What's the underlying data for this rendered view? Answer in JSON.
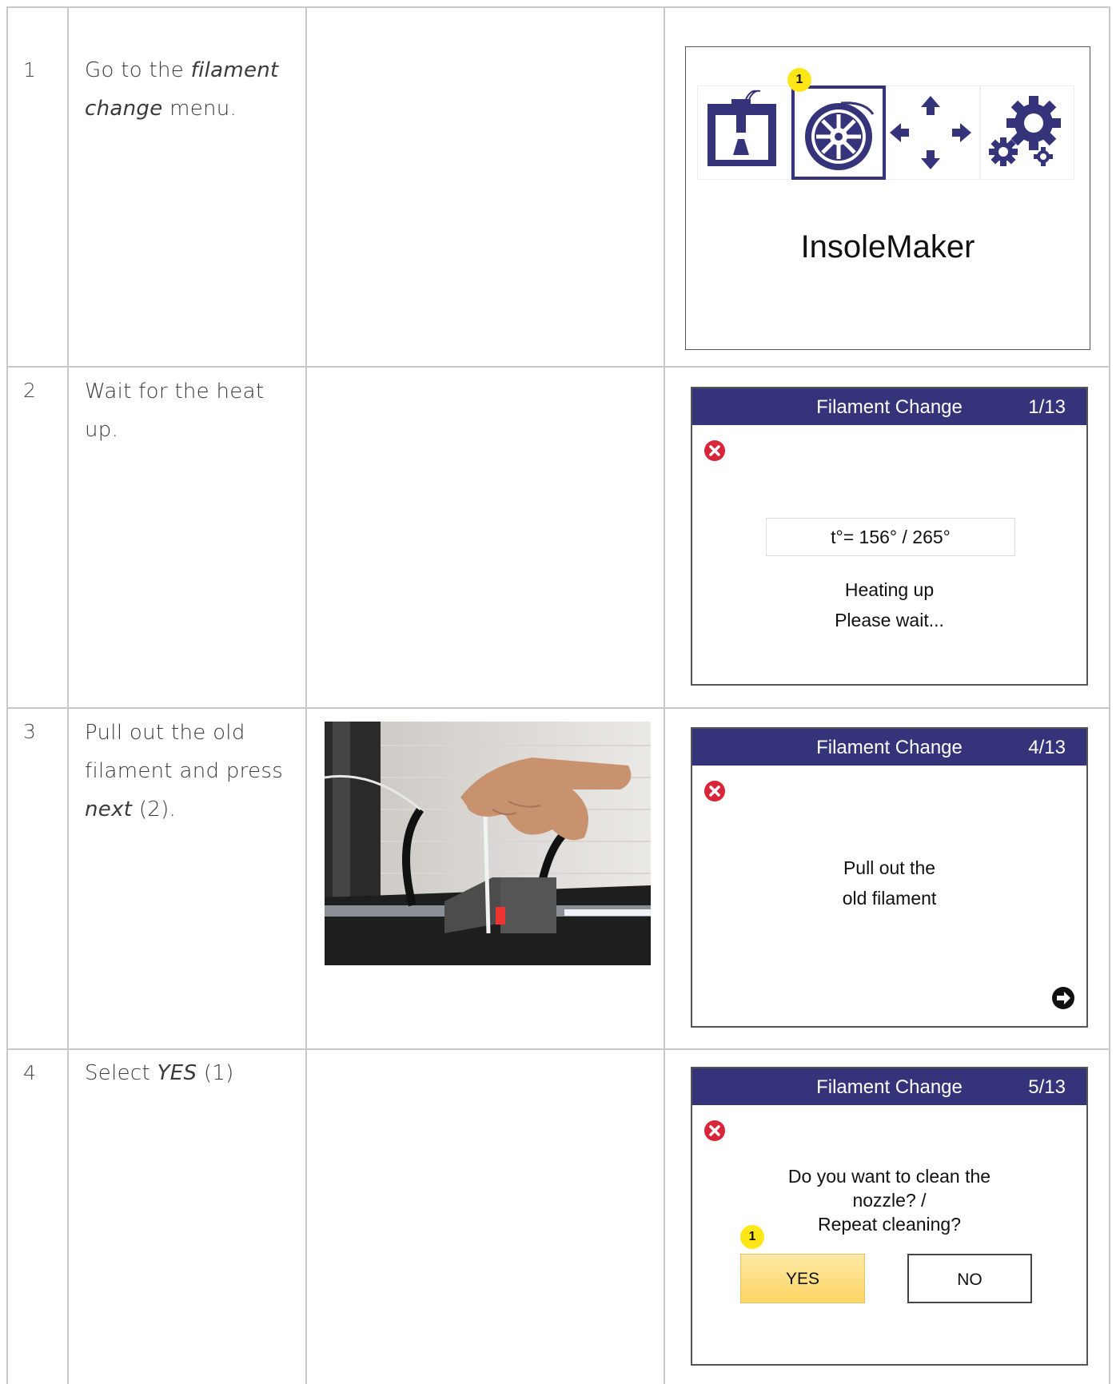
{
  "rows": [
    {
      "number": "1",
      "text_parts": [
        "Go to the ",
        "filament change",
        " menu."
      ]
    },
    {
      "number": "2",
      "text": "Wait for the heat up."
    },
    {
      "number": "3",
      "text_parts": [
        "Pull out the old filament and press ",
        "next",
        " (2)."
      ]
    },
    {
      "number": "4",
      "text_parts": [
        "Select ",
        "YES",
        " (1)"
      ]
    }
  ],
  "menu_screen": {
    "title": "InsoleMaker",
    "marker": "1",
    "icons": [
      "printer-icon",
      "filament-spool-icon",
      "move-arrows-icon",
      "settings-gears-icon"
    ]
  },
  "dialog_heat": {
    "title": "Filament Change",
    "step": "1/13",
    "temperature": "t°= 156° / 265°",
    "line1": "Heating up",
    "line2": "Please wait..."
  },
  "dialog_pull": {
    "title": "Filament Change",
    "step": "4/13",
    "line1": "Pull out the",
    "line2": "old filament"
  },
  "dialog_clean": {
    "title": "Filament Change",
    "step": "5/13",
    "line1": "Do you want to clean the",
    "line2": "nozzle? /",
    "line3": "Repeat cleaning?",
    "yes_label": "YES",
    "no_label": "NO",
    "marker": "1"
  },
  "colors": {
    "dialog_header": "#35337a",
    "marker": "#ffe617",
    "close_icon": "#d9253a",
    "yes_button": "#fcd563"
  }
}
